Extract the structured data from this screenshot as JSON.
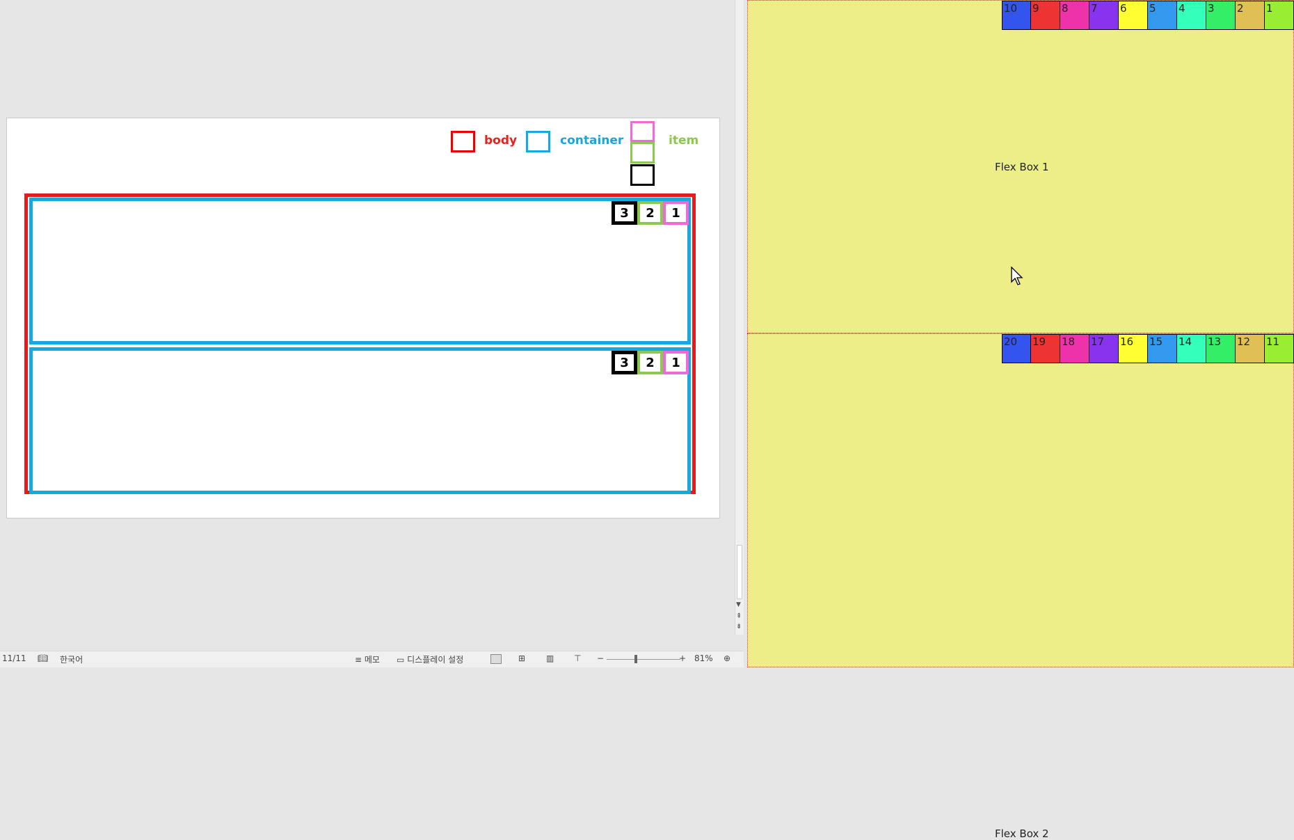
{
  "legend": {
    "body_label": "body",
    "container_label": "container",
    "item_label": "item",
    "colors": {
      "body": "#e51b1b",
      "container": "#18a8e0",
      "item_pink": "#ee6ad8",
      "item_green": "#8dc850",
      "item_black": "#000000"
    }
  },
  "diagram": {
    "containers": [
      {
        "items": [
          "1",
          "2",
          "3"
        ]
      },
      {
        "items": [
          "1",
          "2",
          "3"
        ]
      }
    ]
  },
  "statusbar": {
    "page_count": "11/11",
    "language": "한국어",
    "memo": "메모",
    "display_settings": "디스플레이 설정",
    "zoom_level": "81%"
  },
  "flexboxes": [
    {
      "label": "Flex Box 1",
      "items": [
        {
          "label": "10",
          "color": "#3355ee"
        },
        {
          "label": "9",
          "color": "#ee3333"
        },
        {
          "label": "8",
          "color": "#ee33aa"
        },
        {
          "label": "7",
          "color": "#8833ee"
        },
        {
          "label": "6",
          "color": "#ffff33"
        },
        {
          "label": "5",
          "color": "#3399ee"
        },
        {
          "label": "4",
          "color": "#33ffbb"
        },
        {
          "label": "3",
          "color": "#33ee66"
        },
        {
          "label": "2",
          "color": "#e0c055"
        },
        {
          "label": "1",
          "color": "#99ee33"
        }
      ]
    },
    {
      "label": "Flex Box 2",
      "items": [
        {
          "label": "20",
          "color": "#3355ee"
        },
        {
          "label": "19",
          "color": "#ee3333"
        },
        {
          "label": "18",
          "color": "#ee33aa"
        },
        {
          "label": "17",
          "color": "#8833ee"
        },
        {
          "label": "16",
          "color": "#ffff33"
        },
        {
          "label": "15",
          "color": "#3399ee"
        },
        {
          "label": "14",
          "color": "#33ffbb"
        },
        {
          "label": "13",
          "color": "#33ee66"
        },
        {
          "label": "12",
          "color": "#e0c055"
        },
        {
          "label": "11",
          "color": "#99ee33"
        }
      ]
    }
  ]
}
